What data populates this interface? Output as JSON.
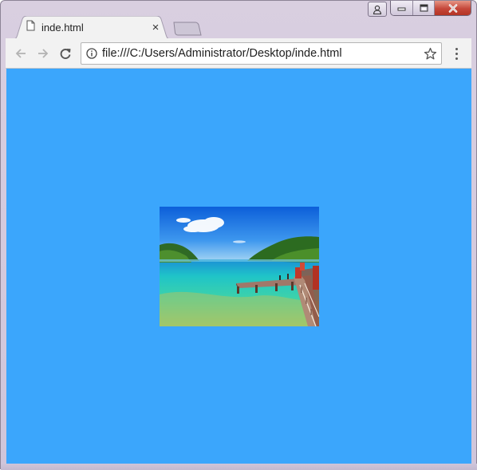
{
  "browser": {
    "tab": {
      "title": "inde.html",
      "icon": "document-icon",
      "close_label": "×"
    },
    "new_tab_icon": "new-tab-icon",
    "address_bar": {
      "url": "file:///C:/Users/Administrator/Desktop/inde.html",
      "info_icon": "info-icon",
      "bookmark_icon": "star-icon"
    },
    "nav": {
      "back_icon": "back-arrow-icon",
      "forward_icon": "forward-arrow-icon",
      "reload_icon": "reload-icon",
      "menu_icon": "more-vertical-icon"
    },
    "window_controls": [
      "user-icon",
      "minimize-icon",
      "maximize-icon",
      "close-icon"
    ]
  },
  "page": {
    "background_color": "#3ba6fc",
    "image": {
      "description_icon": "beach-pier-photo"
    }
  },
  "colors": {
    "viewport_bg": "#3ba6fc",
    "close_button": "#c5473a",
    "window_frame": "#d9cfe0"
  }
}
